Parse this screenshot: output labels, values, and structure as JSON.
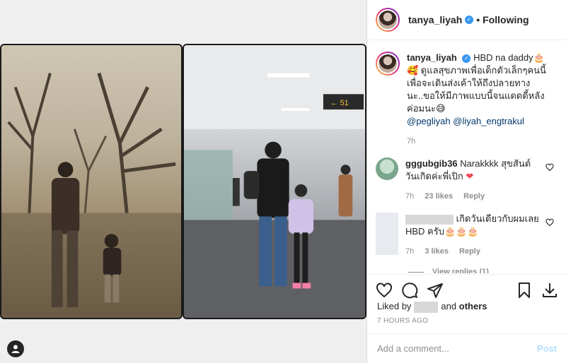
{
  "colors": {
    "accent": "#3897f0",
    "heart": "#ed4956",
    "post_disabled": "#b2dffc"
  },
  "header": {
    "username": "tanya_liyah",
    "verified_icon": "verified-badge-icon",
    "separator": "•",
    "follow_status": "Following"
  },
  "caption": {
    "username": "tanya_liyah",
    "text": "HBD na daddy🎂🥰 ดูแลสุขภาพเพื่อเด็กตัวเล็กๆคนนี้ เพื่อจะเดินส่งเค้าให้ถึงปลายทางนะ..ขอให้มีภาพแบบนี้จนแดดดี้หลังค่อมนะ😅",
    "mentions": [
      "@pegliyah",
      "@liyah_engtrakul"
    ],
    "time": "7h"
  },
  "comments": [
    {
      "username": "gggubgib36",
      "text": "Narakkkk สุขสันต์วันเกิดค่ะพี่เปิก",
      "emoji": "❤",
      "time": "7h",
      "likes": "23 likes",
      "reply_label": "Reply"
    },
    {
      "username": "",
      "text": "เกิดวันเดียวกับผมเลย HBD ครับ🎂🎂🎂",
      "time": "7h",
      "likes": "3 likes",
      "reply_label": "Reply",
      "view_replies": "View replies (1)"
    }
  ],
  "actions": {
    "like_icon": "heart-icon",
    "comment_icon": "comment-icon",
    "share_icon": "share-icon",
    "save_icon": "bookmark-icon",
    "download_icon": "download-icon"
  },
  "likes": {
    "prefix": "Liked by",
    "suffix": "and",
    "others": "others"
  },
  "time_ago": "7 HOURS AGO",
  "add_comment": {
    "placeholder": "Add a comment...",
    "post_label": "Post"
  }
}
